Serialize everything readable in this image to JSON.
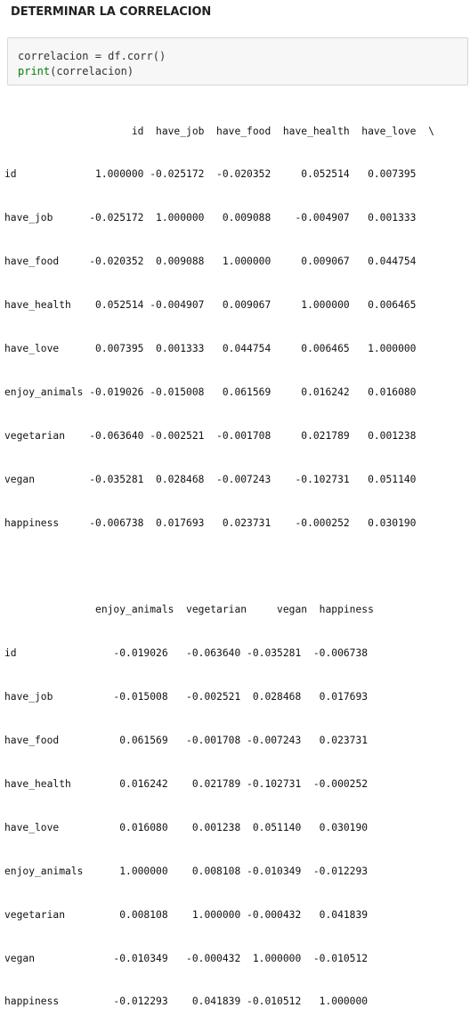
{
  "section_title": "DETERMINAR LA CORRELACION",
  "code": {
    "line1": "correlacion = df.corr()",
    "line2_func": "print",
    "line2_rest": "(correlacion)"
  },
  "output": {
    "block1": [
      "                     id  have_job  have_food  have_health  have_love  \\",
      "id             1.000000 -0.025172  -0.020352     0.052514   0.007395",
      "have_job      -0.025172  1.000000   0.009088    -0.004907   0.001333",
      "have_food     -0.020352  0.009088   1.000000     0.009067   0.044754",
      "have_health    0.052514 -0.004907   0.009067     1.000000   0.006465",
      "have_love      0.007395  0.001333   0.044754     0.006465   1.000000",
      "enjoy_animals -0.019026 -0.015008   0.061569     0.016242   0.016080",
      "vegetarian    -0.063640 -0.002521  -0.001708     0.021789   0.001238",
      "vegan         -0.035281  0.028468  -0.007243    -0.102731   0.051140",
      "happiness     -0.006738  0.017693   0.023731    -0.000252   0.030190"
    ],
    "block2": [
      "               enjoy_animals  vegetarian     vegan  happiness",
      "id                -0.019026   -0.063640 -0.035281  -0.006738",
      "have_job          -0.015008   -0.002521  0.028468   0.017693",
      "have_food          0.061569   -0.001708 -0.007243   0.023731",
      "have_health        0.016242    0.021789 -0.102731  -0.000252",
      "have_love          0.016080    0.001238  0.051140   0.030190",
      "enjoy_animals      1.000000    0.008108 -0.010349  -0.012293",
      "vegetarian         0.008108    1.000000 -0.000432   0.041839",
      "vegan             -0.010349   -0.000432  1.000000  -0.010512",
      "happiness         -0.012293    0.041839 -0.010512   1.000000"
    ]
  }
}
